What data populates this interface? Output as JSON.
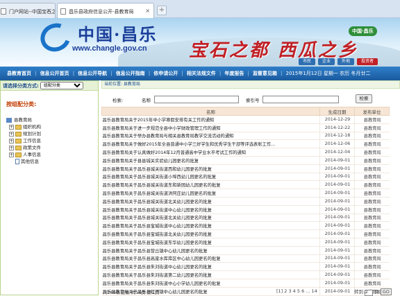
{
  "tabs": [
    {
      "label": "门户网站--中国宝石之都 ↑"
    },
    {
      "label": "昌乐县政府信息公开-县教育局"
    }
  ],
  "banner": {
    "site_name": "中国·昌乐",
    "url": "www.changle.gov.cn",
    "slogan": "宝石之都 西瓜之乡",
    "brand": "中国·昌乐",
    "mini_nav": [
      "市民",
      "企业",
      "外地",
      "投资者"
    ]
  },
  "nav": {
    "items": [
      "县教育首页",
      "信息公开首页",
      "信息公开导航",
      "信息公开指南",
      "依申请公开",
      "相关法规文件",
      "年度报告",
      "监督意见箱"
    ],
    "date": "2015年1月12日 星期一 农历 冬月廿二"
  },
  "sidebar": {
    "type_label": "请选择分类方式:",
    "type_value": "组配分类",
    "cat_title": "按组配分类:",
    "tree": [
      {
        "label": "县教育局",
        "kind": "root"
      },
      {
        "label": "组织机构",
        "kind": "folder"
      },
      {
        "label": "规划计划",
        "kind": "folder"
      },
      {
        "label": "工作信息",
        "kind": "folder"
      },
      {
        "label": "政策文件",
        "kind": "folder"
      },
      {
        "label": "人事信息",
        "kind": "folder"
      },
      {
        "label": "其他信息",
        "kind": "doc"
      }
    ]
  },
  "main": {
    "crumb": "当前位置: 县教育局",
    "search": {
      "keyword_label": "检索:",
      "name_label": "名称",
      "index_label": "索引号",
      "button": "检索"
    },
    "headers": [
      "名称",
      "生成日期",
      "发布单位"
    ],
    "rows": [
      {
        "title": "昌乐县教育局关于2015年中小学寒假安排有关工作的通知",
        "date": "2014-12-29",
        "unit": "县教育局"
      },
      {
        "title": "昌乐县教育局关于进一步规范全县中小学财政管理工作的通知",
        "date": "2014-12-22",
        "unit": "县教育局"
      },
      {
        "title": "昌乐县教育局关于举办县教育局与相关县教育局教学交流活动的通知",
        "date": "2014-12-18",
        "unit": "县教育局"
      },
      {
        "title": "昌乐县教育局关于做好2015年全县普通中小学三好学生和优秀学生干部等评选表彰工作...",
        "date": "2014-12-06",
        "unit": "县教育局"
      },
      {
        "title": "昌乐县教育局关于认真做好2014年12月普通高中学业水平考试工作的通知",
        "date": "2014-12-04",
        "unit": "县教育局"
      },
      {
        "title": "昌乐县教育局关于县县城关实验幼儿园更名的批复",
        "date": "2014-09-01",
        "unit": "县教育局"
      },
      {
        "title": "昌乐县教育局关于昌乐县城关街道西和幼儿园更名的批复",
        "date": "2014-09-01",
        "unit": "县教育局"
      },
      {
        "title": "昌乐县教育局关于昌乐县城关街道小埠西幼儿园更名的批复",
        "date": "2014-09-01",
        "unit": "县教育局"
      },
      {
        "title": "昌乐县教育局关于昌乐县城关街道东和新园幼儿园更名的批复",
        "date": "2014-09-01",
        "unit": "县教育局"
      },
      {
        "title": "昌乐县教育局关于昌乐县城关街道洪阿庄幼儿园更名的批复",
        "date": "2014-09-01",
        "unit": "县教育局"
      },
      {
        "title": "昌乐县教育局关于昌乐县城关街道北关幼儿园更名的批复",
        "date": "2014-09-01",
        "unit": "县教育局"
      },
      {
        "title": "昌乐县教育局关于昌乐县城关街道中心幼儿园更名的批复",
        "date": "2014-09-01",
        "unit": "县教育局"
      },
      {
        "title": "昌乐县教育局关于昌乐县城关街道北关幼儿园更名的批复",
        "date": "2014-09-01",
        "unit": "县教育局"
      },
      {
        "title": "昌乐县教育局关于昌乐县宝城街道中心幼儿园更名的批复",
        "date": "2014-09-01",
        "unit": "县教育局"
      },
      {
        "title": "昌乐县教育局关于昌乐县宝城街道北关幼儿园更名的批复",
        "date": "2014-09-01",
        "unit": "县教育局"
      },
      {
        "title": "昌乐县教育局关于昌乐县宝城街道东华幼儿园更名的批复",
        "date": "2014-09-01",
        "unit": "县教育局"
      },
      {
        "title": "昌乐县教育局关于昌乐县营丘镇中心幼儿园更名的批复",
        "date": "2014-09-01",
        "unit": "县教育局"
      },
      {
        "title": "昌乐县教育局关于昌乐县高崖水库库区中心幼儿园更名的批复",
        "date": "2014-09-01",
        "unit": "县教育局"
      },
      {
        "title": "昌乐县教育局关于昌乐县朱刘街道中心幼儿园更名的批复",
        "date": "2014-09-01",
        "unit": "县教育局"
      },
      {
        "title": "昌乐县教育局关于昌乐县朱刘街道第二幼儿园更名的批复",
        "date": "2014-09-01",
        "unit": "县教育局"
      },
      {
        "title": "昌乐县教育局关于昌乐县朱刘街道中心小学幼儿园更名的批复",
        "date": "2014-09-01",
        "unit": "县教育局"
      },
      {
        "title": "昌乐县教育局关于昌乐县红河镇中心幼儿园更名的批复",
        "date": "2014-09-01",
        "unit": "县教育局"
      }
    ]
  },
  "pager": {
    "summary": "共266条记录 共14页 第1页",
    "pages": "[1] 2 3 4 5 6 ... 14",
    "goto_label": "转到",
    "goto_value": "2",
    "page_unit": "页",
    "go": "GO"
  }
}
